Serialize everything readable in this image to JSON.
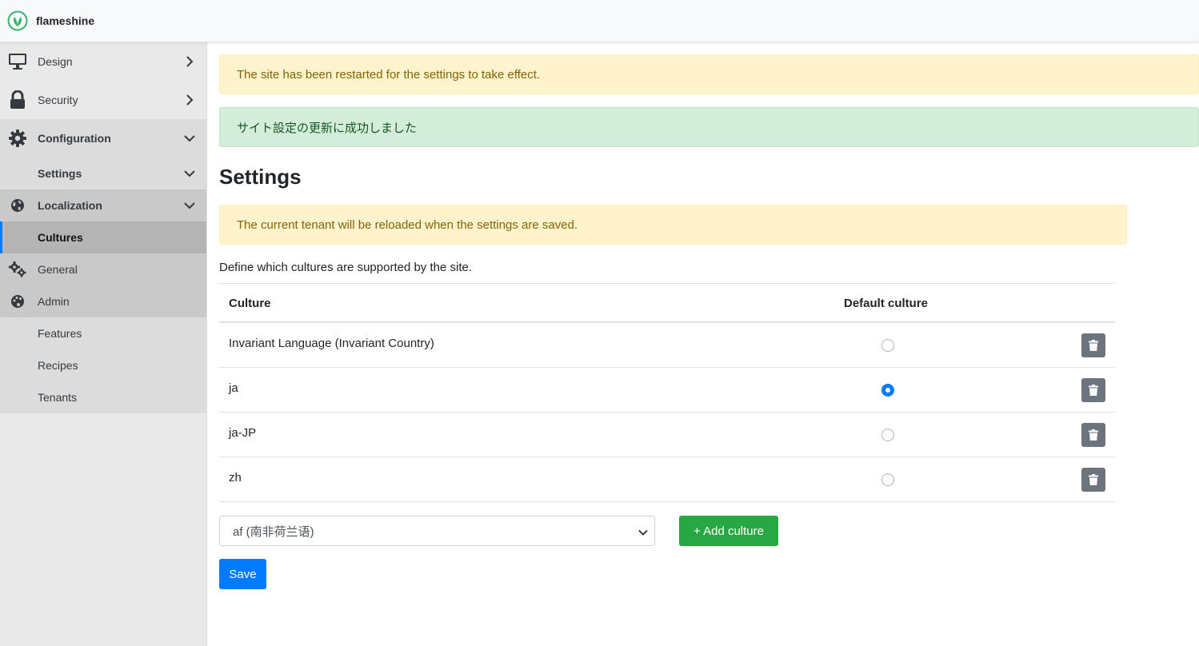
{
  "app": {
    "name": "flameshine"
  },
  "sidebar": {
    "design": {
      "label": "Design",
      "icon": "monitor-icon"
    },
    "security": {
      "label": "Security",
      "icon": "lock-icon"
    },
    "configuration": {
      "label": "Configuration",
      "icon": "gear-icon"
    },
    "settings": {
      "label": "Settings"
    },
    "localization": {
      "label": "Localization",
      "icon": "globe-icon"
    },
    "cultures": {
      "label": "Cultures"
    },
    "general": {
      "label": "General",
      "icon": "gears-icon"
    },
    "admin": {
      "label": "Admin",
      "icon": "palette-icon"
    },
    "features": {
      "label": "Features"
    },
    "recipes": {
      "label": "Recipes"
    },
    "tenants": {
      "label": "Tenants"
    }
  },
  "alerts": {
    "restart": "The site has been restarted for the settings to take effect.",
    "success": "サイト設定の更新に成功しました",
    "reload": "The current tenant will be reloaded when the settings are saved."
  },
  "page": {
    "title": "Settings",
    "description": "Define which cultures are supported by the site."
  },
  "table": {
    "headers": {
      "culture": "Culture",
      "default": "Default culture"
    },
    "rows": [
      {
        "name": "Invariant Language (Invariant Country)",
        "default": false
      },
      {
        "name": "ja",
        "default": true
      },
      {
        "name": "ja-JP",
        "default": false
      },
      {
        "name": "zh",
        "default": false
      }
    ]
  },
  "controls": {
    "selected_culture": "af (南非荷兰语)",
    "add_label": "+ Add culture",
    "save_label": "Save"
  },
  "colors": {
    "primary": "#007bff",
    "success": "#28a745",
    "danger_gray": "#6c757d",
    "brand_green": "#3bb36b"
  }
}
